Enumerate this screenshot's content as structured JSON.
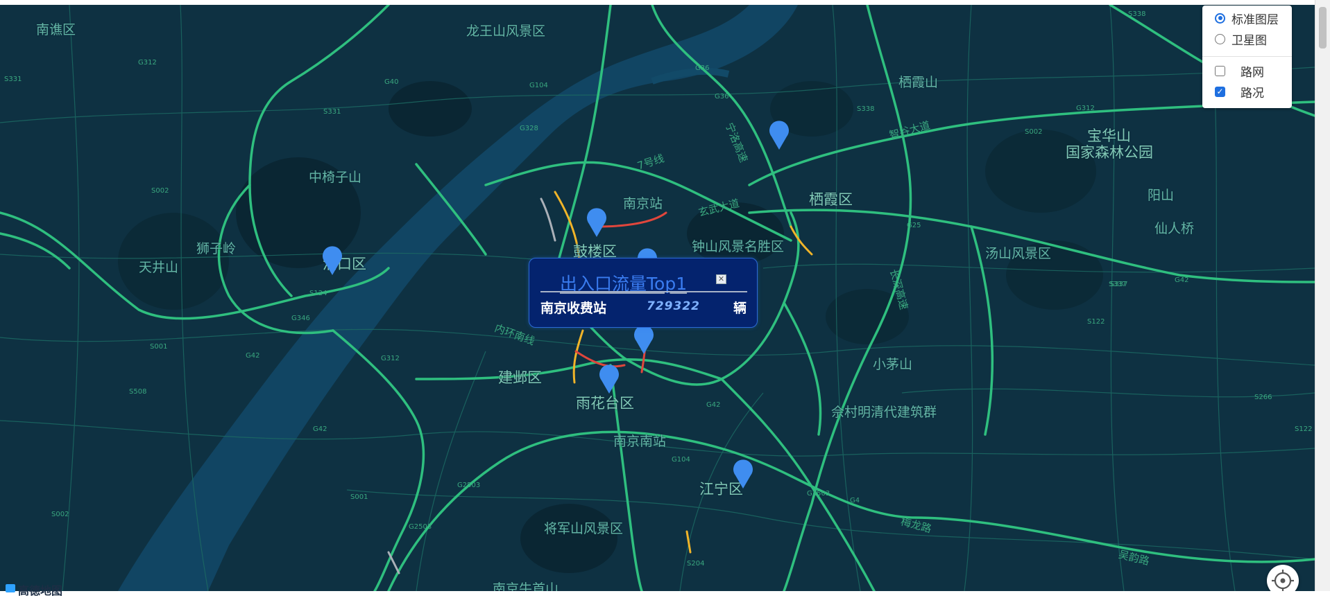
{
  "map": {
    "places": [
      {
        "name": "南谯区",
        "major": false
      },
      {
        "name": "龙王山风景区",
        "major": false
      },
      {
        "name": "栖霞山",
        "major": false
      },
      {
        "name": "宝华山",
        "major": true
      },
      {
        "name": "国家森林公园",
        "major": true
      },
      {
        "name": "中椅子山",
        "major": false
      },
      {
        "name": "南京站",
        "major": false
      },
      {
        "name": "栖霞区",
        "major": true
      },
      {
        "name": "阳山",
        "major": false
      },
      {
        "name": "狮子岭",
        "major": false
      },
      {
        "name": "仙人桥",
        "major": false
      },
      {
        "name": "天井山",
        "major": false
      },
      {
        "name": "鼓楼区",
        "major": true
      },
      {
        "name": "钟山风景名胜区",
        "major": false
      },
      {
        "name": "汤山风景区",
        "major": false
      },
      {
        "name": "浦口区",
        "major": true
      },
      {
        "name": "建邺区",
        "major": true
      },
      {
        "name": "小茅山",
        "major": false
      },
      {
        "name": "雨花台区",
        "major": true
      },
      {
        "name": "佘村明清代建筑群",
        "major": false
      },
      {
        "name": "南京南站",
        "major": false
      },
      {
        "name": "江宁区",
        "major": true
      },
      {
        "name": "将军山风景区",
        "major": false
      },
      {
        "name": "南京牛首山",
        "major": false
      }
    ],
    "road_labels": [
      "G312",
      "S331",
      "G40",
      "G104",
      "S331",
      "G36",
      "G36",
      "S338",
      "G312",
      "S002",
      "G328",
      "S002",
      "S338",
      "G25",
      "S337",
      "G42",
      "S124",
      "G346",
      "S001",
      "G312",
      "S508",
      "S122",
      "G42",
      "S001",
      "S002",
      "S001",
      "G42",
      "G2503",
      "G2503",
      "S204",
      "G104",
      "S204",
      "G2503",
      "G4",
      "S266",
      "S122",
      "S508",
      "G104",
      "S337",
      "G42"
    ],
    "road_name_labels": [
      "7号线",
      "玄武大道",
      "纬七路",
      "内环南线",
      "宁洛高速",
      "长深高速",
      "智谷大道",
      "梅龙路",
      "吴韵路",
      "机场高速"
    ],
    "marker_color": "#3f8df0",
    "base_color": "#0e3142",
    "road_color": "#2fbf7f"
  },
  "layer_control": {
    "base_layers": [
      {
        "label": "标准图层",
        "selected": true
      },
      {
        "label": "卫星图",
        "selected": false
      }
    ],
    "overlays": [
      {
        "label": "路网",
        "checked": false
      },
      {
        "label": "路况",
        "checked": true
      }
    ]
  },
  "popup": {
    "title": "出入口流量Top1",
    "close_symbol": "✕",
    "station": "南京收费站",
    "value": "729322",
    "unit": "辆"
  },
  "footer": {
    "logo_text": "高德地图"
  }
}
